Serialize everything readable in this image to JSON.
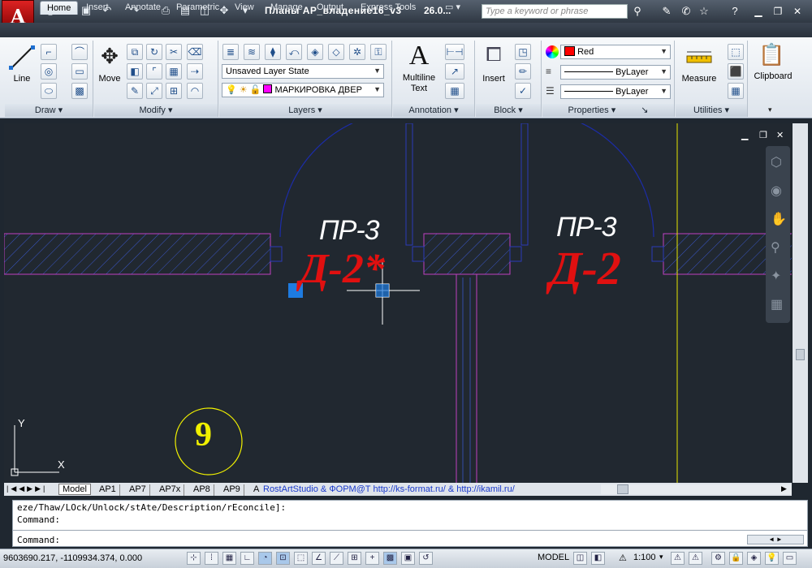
{
  "title_bar": {
    "app_logo": "A",
    "doc_title": "Планы АР_владение16_v3",
    "doc_date": "26.0...",
    "search_placeholder": "Type a keyword or phrase"
  },
  "ribbon_tabs": [
    "Home",
    "Insert",
    "Annotate",
    "Parametric",
    "View",
    "Manage",
    "Output",
    "Express Tools"
  ],
  "ribbon": {
    "draw": {
      "line_label": "Line",
      "title": "Draw"
    },
    "modify": {
      "move_label": "Move",
      "title": "Modify"
    },
    "layers": {
      "layer_state": "Unsaved Layer State",
      "current_layer": "МАРКИРОВКА ДВЕР",
      "title": "Layers"
    },
    "annotation": {
      "mtext_label_1": "Multiline",
      "mtext_label_2": "Text",
      "title": "Annotation"
    },
    "block": {
      "insert_label": "Insert",
      "title": "Block"
    },
    "properties": {
      "color": "Red",
      "linetype": "ByLayer",
      "lineweight": "ByLayer",
      "title": "Properties"
    },
    "utilities": {
      "measure_label": "Measure",
      "title": "Utilities"
    },
    "clipboard": {
      "label": "Clipboard"
    }
  },
  "drawing": {
    "label_pr3_left": "ПР-3",
    "label_d2_left": "Д-2*",
    "label_pr3_right": "ПР-3",
    "label_d2_right": "Д-2",
    "room_number": "9",
    "ucs_y": "Y",
    "ucs_x": "X"
  },
  "drawing_tabs": [
    "Model",
    "AP1",
    "AP7",
    "AP7x",
    "AP8",
    "AP9",
    "A"
  ],
  "watermark": "RostArtStudio & ФОРМ@Т http://ks-format.ru/ & http://ikamil.ru/",
  "command": {
    "history_1": "eze/Thaw/LOck/Unlock/stAte/Description/rEconcile]:",
    "history_2": "Command:",
    "prompt": "Command:"
  },
  "status": {
    "coords": "9603690.217, -1109934.374, 0.000",
    "model": "MODEL",
    "scale": "1:100"
  },
  "colors": {
    "red_label": "#e01010",
    "white_label": "#ffffff",
    "hatch": "#3a56c8",
    "wall": "#c040c0",
    "door_arc": "#1c2ca8",
    "circle": "#f0f000",
    "grip": "#1e7be0"
  }
}
